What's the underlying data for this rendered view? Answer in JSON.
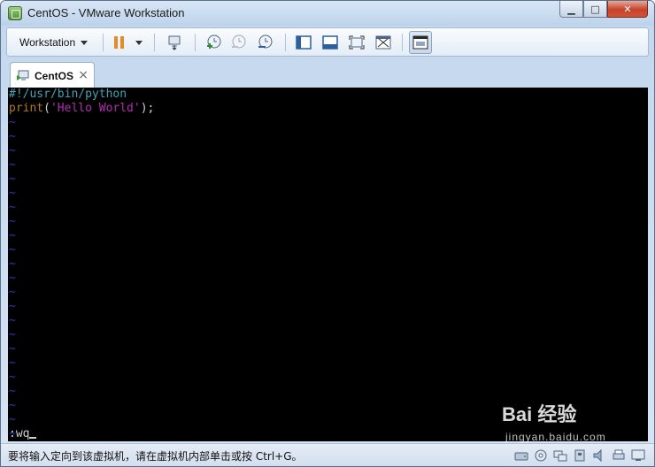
{
  "window": {
    "title": "CentOS - VMware Workstation",
    "controls": {
      "minimize": "▁",
      "maximize": "□",
      "close": "✕"
    }
  },
  "toolbar": {
    "menu_label": "Workstation",
    "icons": [
      "pause-icon",
      "dropdown-icon",
      "send-ctrl-alt-del-icon",
      "snapshot-take-icon",
      "snapshot-revert-icon",
      "snapshot-manager-icon",
      "view-sidebar-icon",
      "view-console-icon",
      "fullscreen-icon",
      "unity-icon",
      "thumbnail-bar-icon"
    ]
  },
  "tabs": [
    {
      "label": "CentOS",
      "close": "×"
    }
  ],
  "console": {
    "line1": "#!/usr/bin/python",
    "line2_fn": "print",
    "line2_open": "(",
    "line2_str": "'Hello World'",
    "line2_close": ");",
    "tilde": "~",
    "tilde_count": 23,
    "command": ":wq"
  },
  "status": {
    "message": "要将输入定向到该虚拟机，请在虚拟机内部单击或按 Ctrl+G。"
  },
  "watermark": {
    "main": "Bai 经验",
    "sub": "jingyan.baidu.com"
  },
  "colors": {
    "console_bg": "#000000",
    "shebang": "#3aa5b5",
    "keyword": "#b07a1a",
    "string": "#b32ab3",
    "tilde": "#2338c8"
  }
}
